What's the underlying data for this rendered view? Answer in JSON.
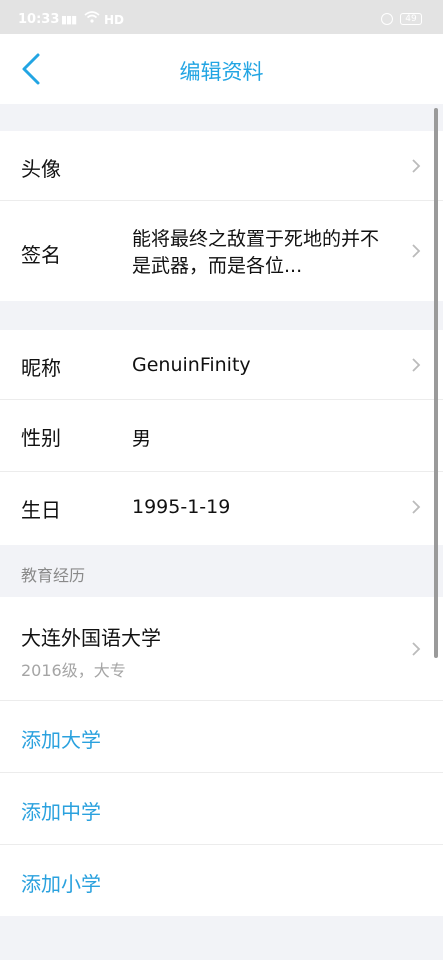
{
  "statusbar": {
    "time": "10:33",
    "signal": "4G",
    "network": "HD",
    "battery": "49"
  },
  "nav": {
    "title": "编辑资料"
  },
  "profile": {
    "avatar_label": "头像",
    "signature_label": "签名",
    "signature_value": "能将最终之敌置于死地的并不是武器，而是各位..."
  },
  "info": {
    "nickname_label": "昵称",
    "nickname_value": "GenuinFinity",
    "gender_label": "性别",
    "gender_value": "男",
    "birthday_label": "生日",
    "birthday_value": "1995-1-19"
  },
  "education": {
    "header": "教育经历",
    "school": "大连外国语大学",
    "detail": "2016级，大专",
    "add_university": "添加大学",
    "add_middle_school": "添加中学",
    "add_primary_school": "添加小学"
  },
  "colors": {
    "accent": "#22a5e3",
    "link": "#2aa1de",
    "background": "#f2f3f7"
  },
  "icons": {
    "back": "chevron-left-icon",
    "row_arrow": "chevron-right-icon"
  }
}
